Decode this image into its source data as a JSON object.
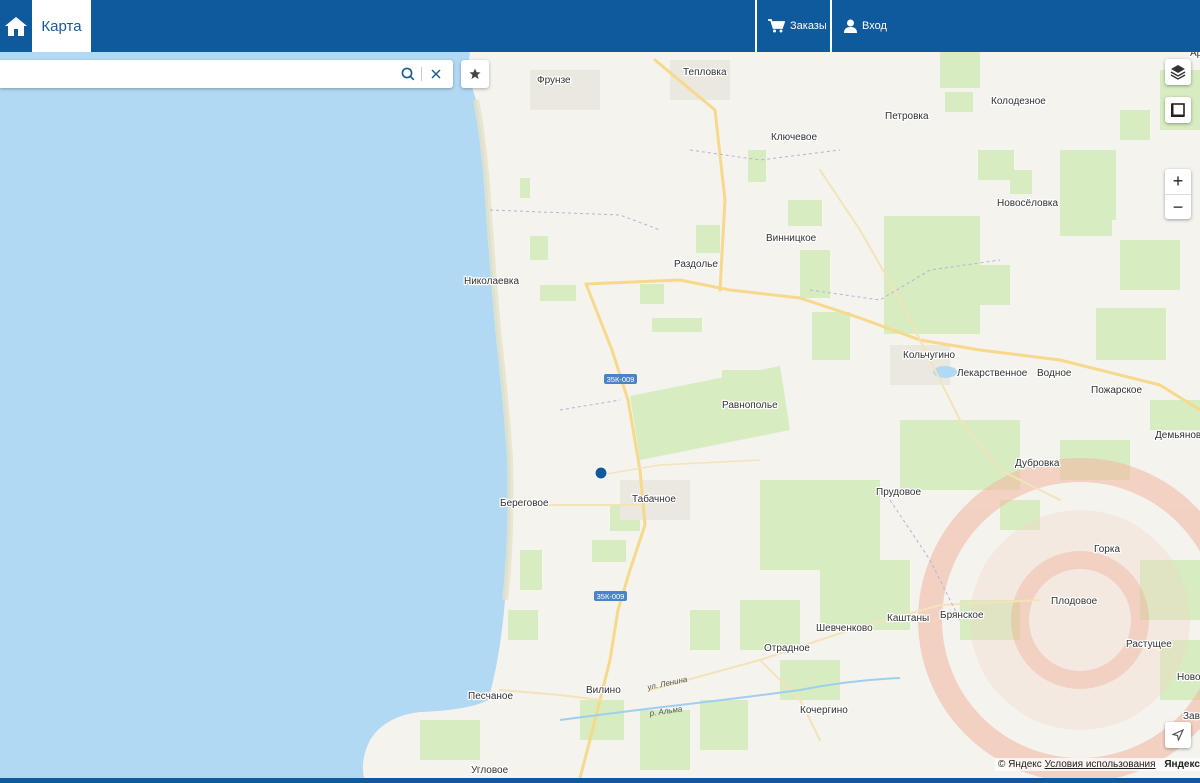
{
  "header": {
    "tab_map_label": "Карта",
    "orders_label": "Заказы",
    "login_label": "Вход"
  },
  "search": {
    "placeholder": "",
    "value": ""
  },
  "map": {
    "places": [
      {
        "name": "Фрунзе"
      },
      {
        "name": "Тепловка"
      },
      {
        "name": "Колодезное"
      },
      {
        "name": "Петровка"
      },
      {
        "name": "Ключевое"
      },
      {
        "name": "Новосёловка"
      },
      {
        "name": "Винницкое"
      },
      {
        "name": "Раздолье"
      },
      {
        "name": "Николаевка"
      },
      {
        "name": "Кольчугино"
      },
      {
        "name": "Лекарственное"
      },
      {
        "name": "Водное"
      },
      {
        "name": "Пожарское"
      },
      {
        "name": "Равнополье"
      },
      {
        "name": "Демьяновка"
      },
      {
        "name": "Дубровка"
      },
      {
        "name": "Береговое"
      },
      {
        "name": "Табачное"
      },
      {
        "name": "Прудовое"
      },
      {
        "name": "Горка"
      },
      {
        "name": "Плодовое"
      },
      {
        "name": "Брянское"
      },
      {
        "name": "Каштаны"
      },
      {
        "name": "Шевченково"
      },
      {
        "name": "Растущее"
      },
      {
        "name": "Отрадное"
      },
      {
        "name": "Ново"
      },
      {
        "name": "Песчаное"
      },
      {
        "name": "Вилино"
      },
      {
        "name": "Кочергино"
      },
      {
        "name": "Зав"
      },
      {
        "name": "Угловое"
      },
      {
        "name": "Ар"
      }
    ],
    "road_labels": [
      "35К-009",
      "35К-009"
    ],
    "streets": [
      "ул. Ленина",
      "р. Альма"
    ],
    "copyright": {
      "prefix": "© Яндекс",
      "terms": "Условия использования",
      "brand": "Яндекс"
    },
    "colors": {
      "sea": "#b1d9f4",
      "land": "#f4f3ee",
      "field": "#d7ecc1",
      "road_main": "#f7d98b",
      "road_badge": "#4a84c7",
      "marker": "#125a9c"
    }
  }
}
